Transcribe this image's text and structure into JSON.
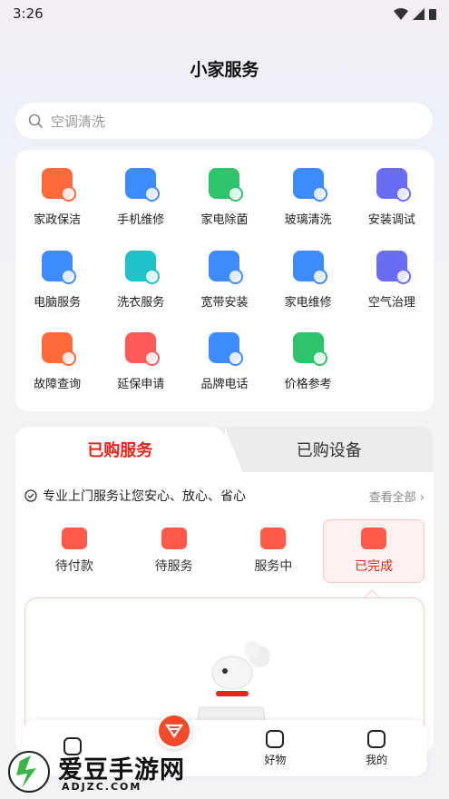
{
  "status": {
    "time": "3:26"
  },
  "header": {
    "title": "小家服务"
  },
  "search": {
    "placeholder": "空调清洗"
  },
  "services": [
    {
      "label": "家政保洁",
      "icon": "broom-icon",
      "color": "#ff6a3d"
    },
    {
      "label": "手机维修",
      "icon": "phone-repair-icon",
      "color": "#3d8bff"
    },
    {
      "label": "家电除菌",
      "icon": "sterilize-icon",
      "color": "#2fc36b"
    },
    {
      "label": "玻璃清洗",
      "icon": "glass-clean-icon",
      "color": "#3d8bff"
    },
    {
      "label": "安装调试",
      "icon": "install-icon",
      "color": "#6a6cf5"
    },
    {
      "label": "电脑服务",
      "icon": "computer-icon",
      "color": "#3d8bff"
    },
    {
      "label": "洗衣服务",
      "icon": "laundry-icon",
      "color": "#1fc2c9"
    },
    {
      "label": "宽带安装",
      "icon": "router-icon",
      "color": "#3d8bff"
    },
    {
      "label": "家电维修",
      "icon": "appliance-repair-icon",
      "color": "#3d8bff"
    },
    {
      "label": "空气治理",
      "icon": "spray-icon",
      "color": "#6a6cf5"
    },
    {
      "label": "故障查询",
      "icon": "fault-query-icon",
      "color": "#ff6a3d"
    },
    {
      "label": "延保申请",
      "icon": "warranty-icon",
      "color": "#ff5a5a"
    },
    {
      "label": "品牌电话",
      "icon": "brand-phone-icon",
      "color": "#3d8bff"
    },
    {
      "label": "价格参考",
      "icon": "price-icon",
      "color": "#2fc36b"
    }
  ],
  "service_tabs": {
    "active": "已购服务",
    "inactive": "已购设备"
  },
  "note": {
    "text": "专业上门服务让您安心、放心、省心",
    "view_all": "查看全部"
  },
  "orders": [
    {
      "label": "待付款",
      "icon": "wallet-icon"
    },
    {
      "label": "待服务",
      "icon": "location-icon"
    },
    {
      "label": "服务中",
      "icon": "in-progress-icon"
    },
    {
      "label": "已完成",
      "icon": "calendar-check-icon"
    }
  ],
  "bottom_nav": [
    {
      "label": "",
      "icon": "home-icon"
    },
    {
      "label": "",
      "icon": "center-heart-icon"
    },
    {
      "label": "好物",
      "icon": "goods-icon"
    },
    {
      "label": "我的",
      "icon": "profile-icon"
    }
  ],
  "watermark": {
    "text": "爱豆手游网",
    "url": "ADJZC.COM"
  },
  "colors": {
    "accent": "#e8231a",
    "page_bg": "#f3f3f6"
  }
}
